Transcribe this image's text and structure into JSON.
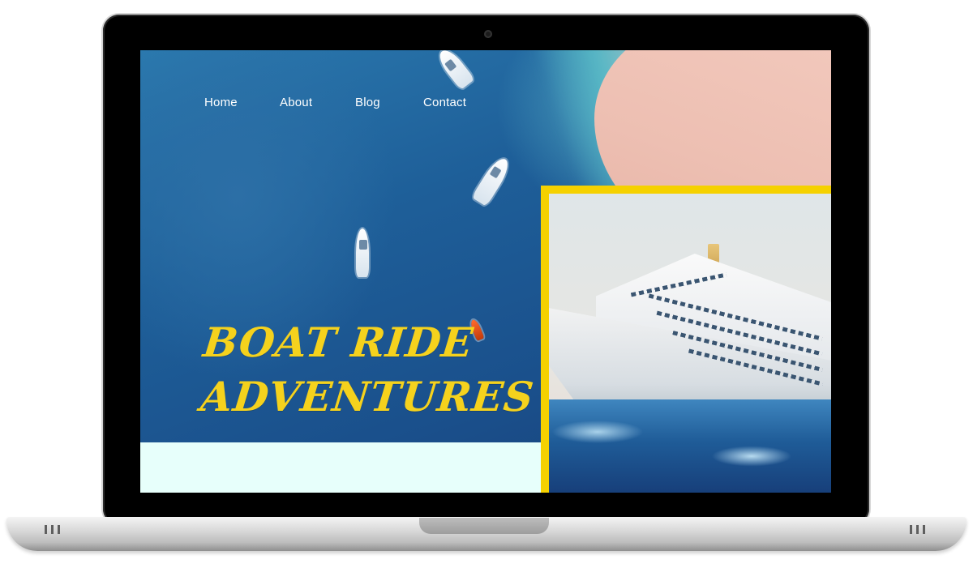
{
  "nav": {
    "home": "Home",
    "about": "About",
    "blog": "Blog",
    "contact": "Contact"
  },
  "hero": {
    "title_line1": "BOAT RIDE",
    "title_line2": "ADVENTURES"
  },
  "colors": {
    "accent_yellow": "#f5d21d",
    "frame_yellow": "#f5d100",
    "light_panel": "#e7fffb",
    "laptop_bezel": "#000000"
  },
  "icons": [
    "camera-icon"
  ]
}
